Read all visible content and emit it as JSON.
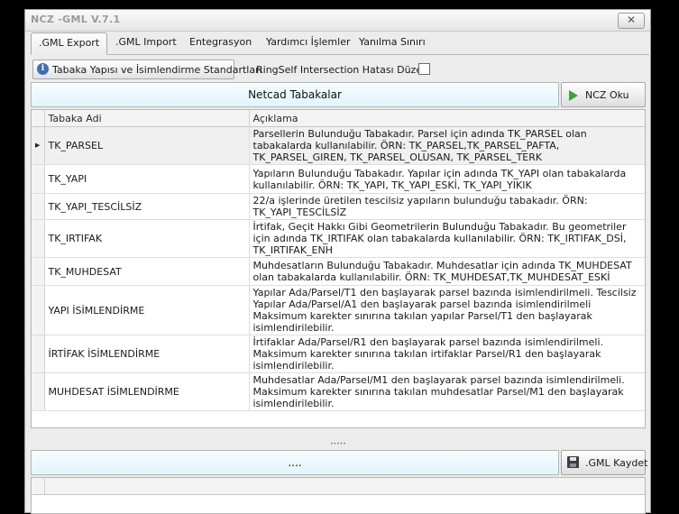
{
  "window": {
    "title": "NCZ -GML V.7.1",
    "close_label": "✕"
  },
  "tabs": [
    {
      "label": ".GML Export",
      "active": true
    },
    {
      "label": ".GML Import"
    },
    {
      "label": "Entegrasyon"
    },
    {
      "label": "Yardımcı İşlemler"
    },
    {
      "label": "Yanılma Sınırı"
    }
  ],
  "info_button": {
    "label": "Tabaka Yapısı ve İsimlendirme Standartları",
    "icon": "info-icon"
  },
  "ring_self": {
    "label": "RingSelf Intersection Hatası Düzelt",
    "checked": false
  },
  "top_panel": {
    "banner": "Netcad Tabakalar",
    "button_label": "NCZ Oku",
    "button_icon": "play-icon"
  },
  "grid": {
    "columns": [
      "Tabaka Adi",
      "Açıklama"
    ],
    "rows": [
      {
        "name": "TK_PARSEL",
        "desc": "Parsellerin Bulunduğu Tabakadır. Parsel için adında TK_PARSEL olan tabakalarda kullanılabilir. ÖRN: TK_PARSEL,TK_PARSEL_PAFTA, TK_PARSEL_GIREN, TK_PARSEL_OLUSAN, TK_PARSEL_TERK",
        "selected": true
      },
      {
        "name": "TK_YAPI",
        "desc": "Yapıların Bulunduğu Tabakadır. Yapılar için adında TK_YAPI olan tabakalarda kullanılabilir. ÖRN: TK_YAPI, TK_YAPI_ESKİ, TK_YAPI_YIKIK"
      },
      {
        "name": "TK_YAPI_TESCİLSİZ",
        "desc": "22/a işlerinde üretilen tescilsiz yapıların bulunduğu tabakadır. ÖRN: TK_YAPI_TESCİLSİZ"
      },
      {
        "name": "TK_IRTIFAK",
        "desc": "İrtifak, Geçit Hakkı Gibi Geometrilerin Bulunduğu Tabakadır. Bu geometriler için adında TK_IRTIFAK olan tabakalarda kullanılabilir. ÖRN: TK_IRTIFAK_DSİ, TK_IRTIFAK_ENH"
      },
      {
        "name": "TK_MUHDESAT",
        "desc": "Muhdesatların Bulunduğu Tabakadır. Muhdesatlar için adında TK_MUHDESAT olan tabakalarda kullanılabilir. ÖRN: TK_MUHDESAT,TK_MUHDESAT_ESKİ"
      },
      {
        "name": "YAPI İSİMLENDİRME",
        "desc": "Yapılar Ada/Parsel/T1 den başlayarak parsel bazında isimlendirilmeli. Tescilsiz Yapılar Ada/Parsel/A1 den başlayarak parsel bazında isimlendirilmeli Maksimum karekter sınırına takılan yapılar Parsel/T1 den başlayarak isimlendirilebilir."
      },
      {
        "name": "İRTİFAK İSİMLENDİRME",
        "desc": "İrtifaklar Ada/Parsel/R1 den başlayarak parsel bazında isimlendirilmeli. Maksimum karekter sınırına takılan irtifaklar Parsel/R1 den başlayarak isimlendirilebilir."
      },
      {
        "name": "MUHDESAT İSİMLENDİRME",
        "desc": "Muhdesatlar Ada/Parsel/M1 den başlayarak parsel bazında isimlendirilmeli. Maksimum karekter sınırına takılan muhdesatlar Parsel/M1 den başlayarak isimlendirilebilir."
      }
    ]
  },
  "bottom_panel": {
    "banner": "....",
    "button_label": ".GML Kaydet",
    "button_icon": "save-icon"
  }
}
